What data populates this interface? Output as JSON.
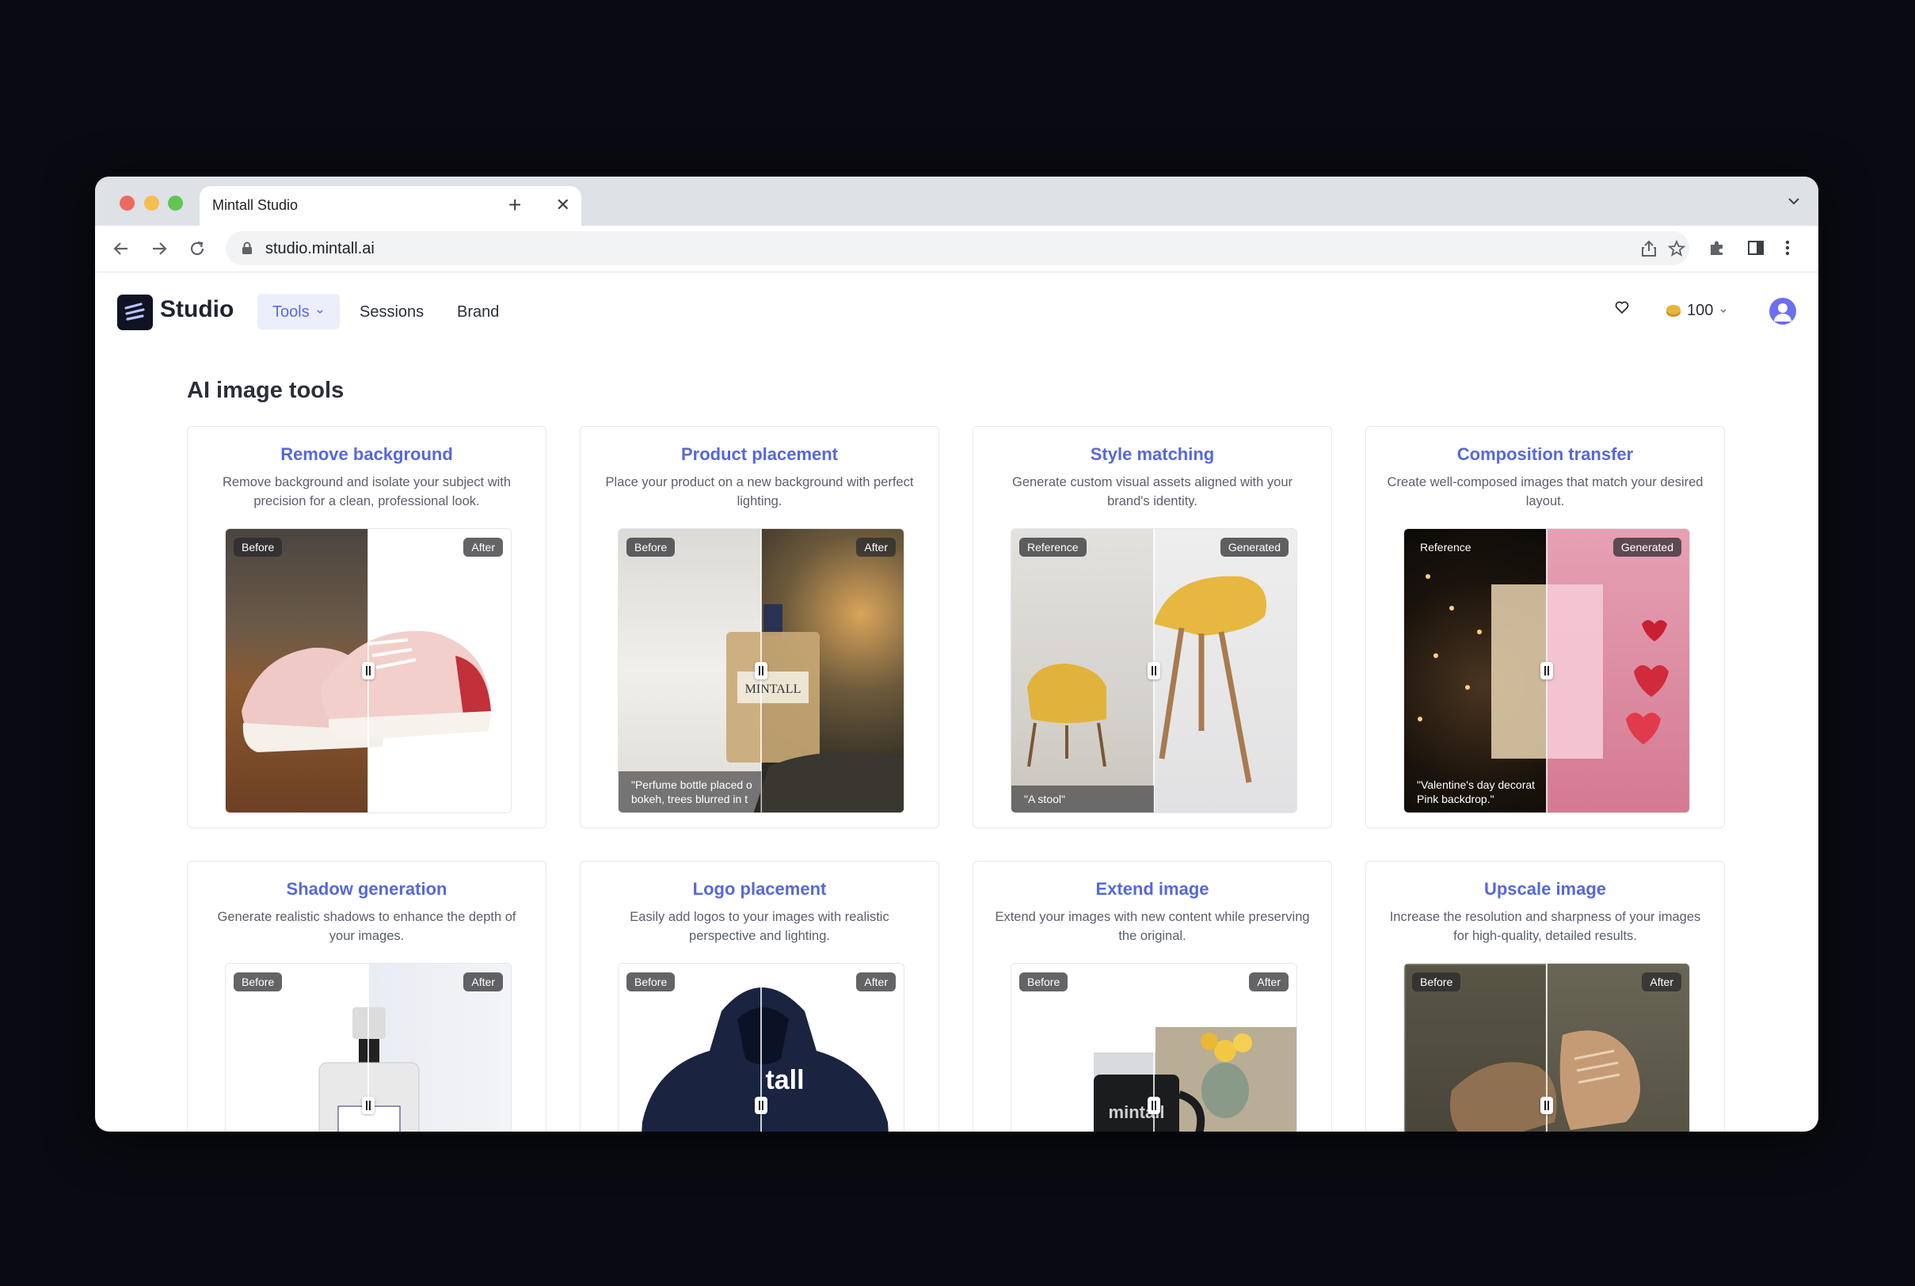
{
  "browser": {
    "tab_title": "Mintall Studio",
    "url": "studio.mintall.ai"
  },
  "app": {
    "brand": "Studio",
    "nav": {
      "tools": "Tools",
      "sessions": "Sessions",
      "brand": "Brand"
    },
    "credits": "100"
  },
  "page": {
    "title": "AI image tools"
  },
  "tools": [
    {
      "title": "Remove background",
      "description": "Remove background and isolate your subject with precision for a clean, professional look.",
      "left_label": "Before",
      "right_label": "After",
      "prompt": ""
    },
    {
      "title": "Product placement",
      "description": "Place your product on a new background with perfect lighting.",
      "left_label": "Before",
      "right_label": "After",
      "prompt": "\"Perfume bottle placed o\nbokeh, trees blurred in t"
    },
    {
      "title": "Style matching",
      "description": "Generate custom visual assets aligned with your brand's identity.",
      "left_label": "Reference",
      "right_label": "Generated",
      "prompt": "\"A stool\""
    },
    {
      "title": "Composition transfer",
      "description": "Create well-composed images that match your desired layout.",
      "left_label": "Reference",
      "right_label": "Generated",
      "prompt": "\"Valentine's day decorat\nPink backdrop.\""
    },
    {
      "title": "Shadow generation",
      "description": "Generate realistic shadows to enhance the depth of your images.",
      "left_label": "Before",
      "right_label": "After",
      "prompt": ""
    },
    {
      "title": "Logo placement",
      "description": "Easily add logos to your images with realistic perspective and lighting.",
      "left_label": "Before",
      "right_label": "After",
      "prompt": ""
    },
    {
      "title": "Extend image",
      "description": "Extend your images with new content while preserving the original.",
      "left_label": "Before",
      "right_label": "After",
      "prompt": ""
    },
    {
      "title": "Upscale image",
      "description": "Increase the resolution and sharpness of your images for high-quality, detailed results.",
      "left_label": "Before",
      "right_label": "After",
      "prompt": ""
    }
  ],
  "product_text": {
    "perfume_label": "MINTALL",
    "hoodie_text": "tall",
    "mug_text": "mintall"
  }
}
